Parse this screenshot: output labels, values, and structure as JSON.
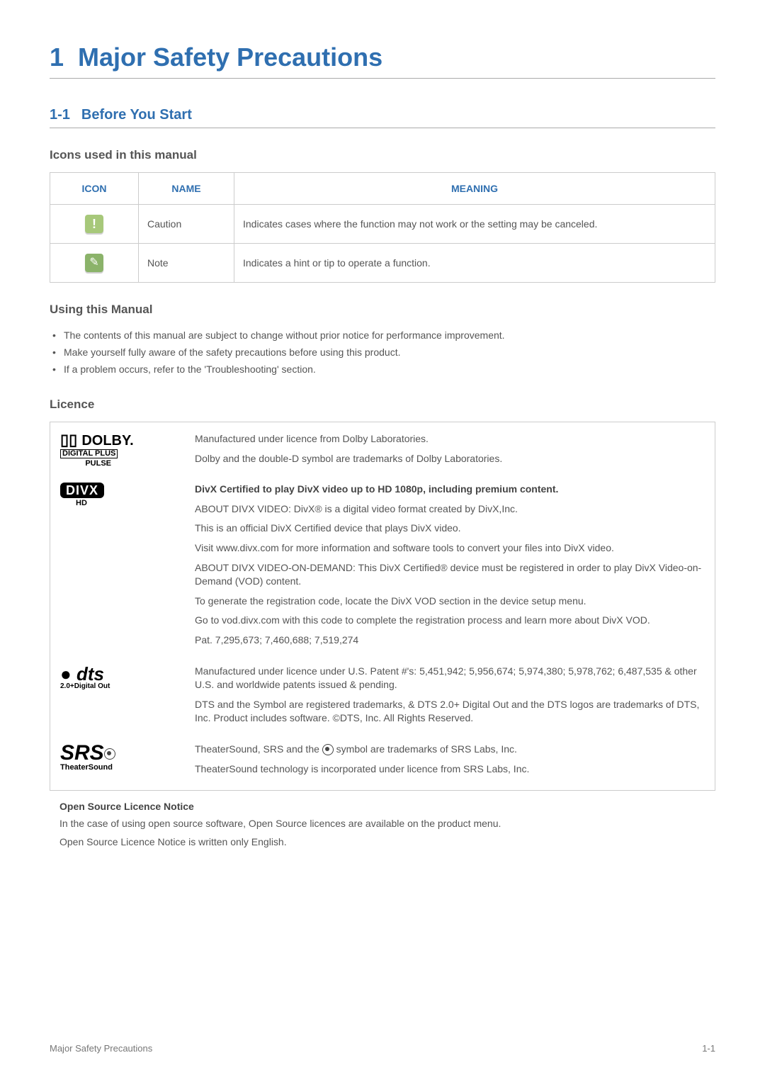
{
  "chapter": {
    "num": "1",
    "title": "Major Safety Precautions"
  },
  "section": {
    "num": "1-1",
    "title": "Before You Start"
  },
  "iconsHeading": "Icons used in this manual",
  "table": {
    "headers": {
      "icon": "ICON",
      "name": "NAME",
      "meaning": "MEANING"
    },
    "rows": [
      {
        "name": "Caution",
        "meaning": "Indicates cases where the function may not work or the setting may be canceled."
      },
      {
        "name": "Note",
        "meaning": "Indicates a hint or tip to operate a function."
      }
    ]
  },
  "usingHeading": "Using this Manual",
  "usingBullets": [
    "The contents of this manual are subject to change without prior notice for performance improvement.",
    "Make yourself fully aware of the safety precautions before using this product.",
    "If a problem occurs, refer to the 'Troubleshooting' section."
  ],
  "licenceHeading": "Licence",
  "dolby": {
    "logoTop": "DOLBY.",
    "logoMid": "DIGITAL PLUS",
    "logoBot": "PULSE",
    "p1": "Manufactured under licence from Dolby Laboratories.",
    "p2": "Dolby and the double-D symbol are trademarks of Dolby Laboratories."
  },
  "divx": {
    "logoBox": "DIVX",
    "logoHd": "HD",
    "p1": "DivX Certified to play DivX video up to HD 1080p, including premium content.",
    "p2": "ABOUT DIVX VIDEO: DivX® is a digital video format created by DivX,Inc.",
    "p3": "This is an official DivX Certified device that plays DivX video.",
    "p4": "Visit www.divx.com for more information and software tools to convert your files into DivX video.",
    "p5": "ABOUT DIVX VIDEO-ON-DEMAND: This DivX Certified® device must be registered in order to play DivX Video-on-Demand (VOD) content.",
    "p6": "To generate the registration code, locate the DivX VOD section in the device setup menu.",
    "p7": "Go to vod.divx.com with this code to complete the registration process and learn more about DivX VOD.",
    "p8": "Pat. 7,295,673; 7,460,688; 7,519,274"
  },
  "dts": {
    "logoTop": "dts",
    "logoSub": "2.0+Digital Out",
    "p1": "Manufactured under licence under U.S. Patent #'s: 5,451,942; 5,956,674; 5,974,380; 5,978,762; 6,487,535 & other U.S. and worldwide patents issued & pending.",
    "p2": "DTS and the Symbol are registered trademarks, & DTS 2.0+ Digital Out and the DTS logos are trademarks of DTS, Inc. Product includes software. ©DTS, Inc. All Rights Reserved."
  },
  "srs": {
    "logoTop": "SRS",
    "logoSub": "TheaterSound",
    "p1a": "TheaterSound, SRS and the ",
    "p1b": " symbol are trademarks of SRS Labs, Inc.",
    "p2": "TheaterSound technology is incorporated under licence from SRS Labs, Inc."
  },
  "openSource": {
    "title": "Open Source Licence Notice",
    "p1": "In the case of using open source software, Open Source licences are available on the product menu.",
    "p2": "Open Source Licence Notice is written only English."
  },
  "footer": {
    "left": "Major Safety Precautions",
    "right": "1-1"
  }
}
